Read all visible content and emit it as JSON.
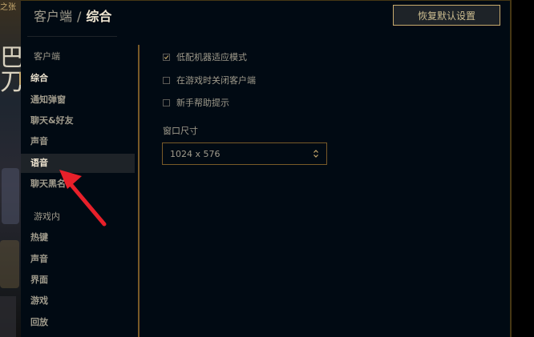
{
  "background": {
    "corner_text": "之张",
    "big_text": "巴刀"
  },
  "header": {
    "breadcrumb_parent": "客户端",
    "separator": "/",
    "breadcrumb_current": "综合",
    "reset_label": "恢复默认设置"
  },
  "sidebar": {
    "client_header": "客户端",
    "client_items": [
      {
        "label": "综合"
      },
      {
        "label": "通知弹窗"
      },
      {
        "label": "聊天&好友"
      },
      {
        "label": "声音"
      },
      {
        "label": "语音"
      },
      {
        "label": "聊天黑名"
      }
    ],
    "ingame_header": "游戏内",
    "ingame_items": [
      {
        "label": "热键"
      },
      {
        "label": "声音"
      },
      {
        "label": "界面"
      },
      {
        "label": "游戏"
      },
      {
        "label": "回放"
      }
    ]
  },
  "settings": {
    "options": [
      {
        "label": "低配机器适应模式",
        "checked": true
      },
      {
        "label": "在游戏时关闭客户端",
        "checked": false
      },
      {
        "label": "新手帮助提示",
        "checked": false
      }
    ],
    "window_size_label": "窗口尺寸",
    "window_size_value": "1024 x 576"
  },
  "colors": {
    "gold": "#c8aa6e",
    "gold_dark": "#785a28",
    "text": "#a09b8c",
    "text_bright": "#f0e6d2",
    "bg": "#010a13",
    "annotation_arrow": "#e8202a"
  }
}
